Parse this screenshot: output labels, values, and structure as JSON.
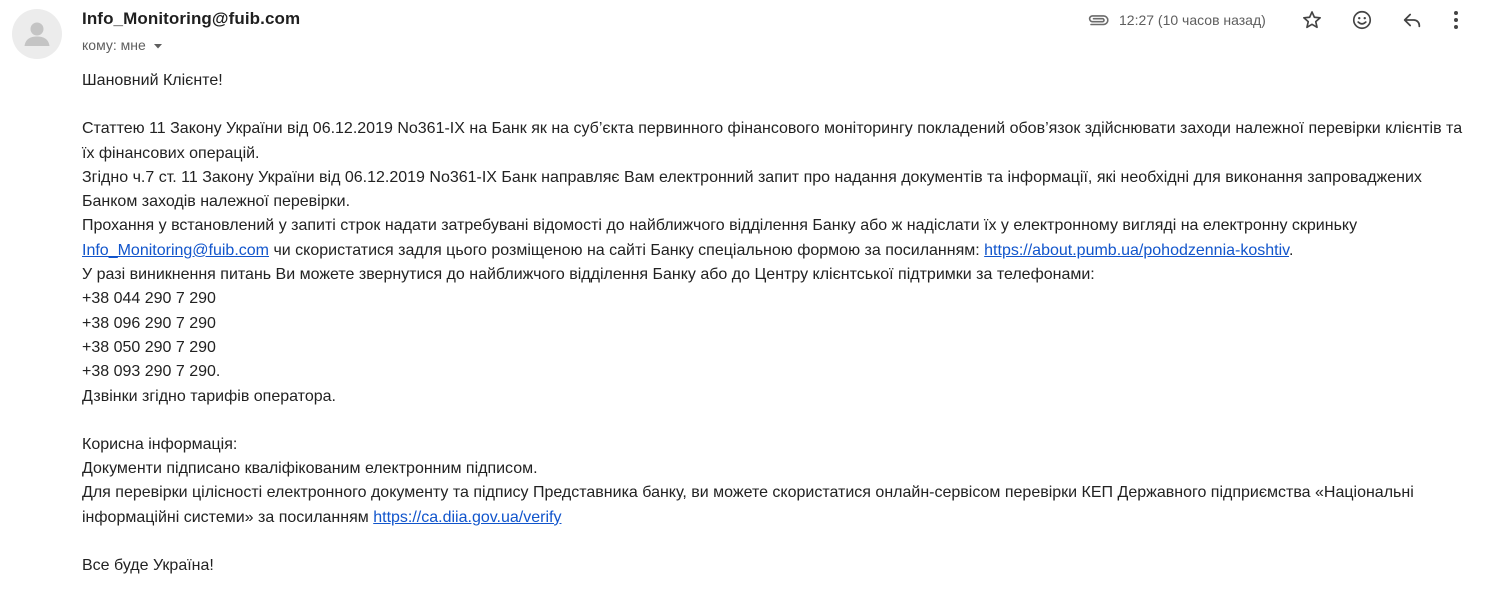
{
  "header": {
    "sender": "Info_Monitoring@fuib.com",
    "recipient_label": "кому: мне",
    "time": "12:27 (10 часов назад)",
    "icons": [
      "avatar-icon",
      "paperclip-icon",
      "star-icon",
      "emoji-icon",
      "reply-icon",
      "more-vert-icon"
    ]
  },
  "body": {
    "greeting": "Шановний Клієнте!",
    "p1": "Статтею 11 Закону України від 06.12.2019 No361-IX на Банк як на суб’єкта первинного фінансового моніторингу покладений обов’язок здійснювати заходи належної перевірки клієнтів та їх фінансових операцій.",
    "p2": "Згідно ч.7 ст. 11 Закону України від 06.12.2019 No361-IX Банк направляє Вам електронний запит про надання документів та інформації, які необхідні для виконання запроваджених Банком заходів належної перевірки.",
    "p3_before": "Прохання у встановлений у запиті строк надати затребувані відомості до найближчого відділення Банку або ж надіслати їх у електронному вигляді на електронну скриньку",
    "p3_email": "Info_Monitoring@fuib.com",
    "p3_middle": "чи скористатися задля цього розміщеною на сайті Банку спеціальною формою за посиланням:",
    "p3_link": "https://about.pumb.ua/pohodzennia-koshtiv",
    "p3_end": ".",
    "p4": "У разі виникнення питань Ви можете звернутися до найближчого відділення Банку або до Центру клієнтської підтримки за телефонами:",
    "phones": [
      "+38 044 290 7 290",
      "+38 096 290 7 290",
      "+38 050 290 7 290",
      "+38 093 290 7 290."
    ],
    "calls_note": "Дзвінки згідно тарифів оператора.",
    "useful_title": "Корисна інформація:",
    "signed_note": "Документи підписано кваліфікованим електронним підписом.",
    "verify_before": "Для перевірки цілісності електронного документу та підпису Представника банку, ви можете скористатися онлайн-сервісом перевірки КЕП Державного підприємства «Національні інформаційні системи» за посиланням",
    "verify_link": "https://ca.diia.gov.ua/verify",
    "closing": "Все буде Україна!"
  }
}
